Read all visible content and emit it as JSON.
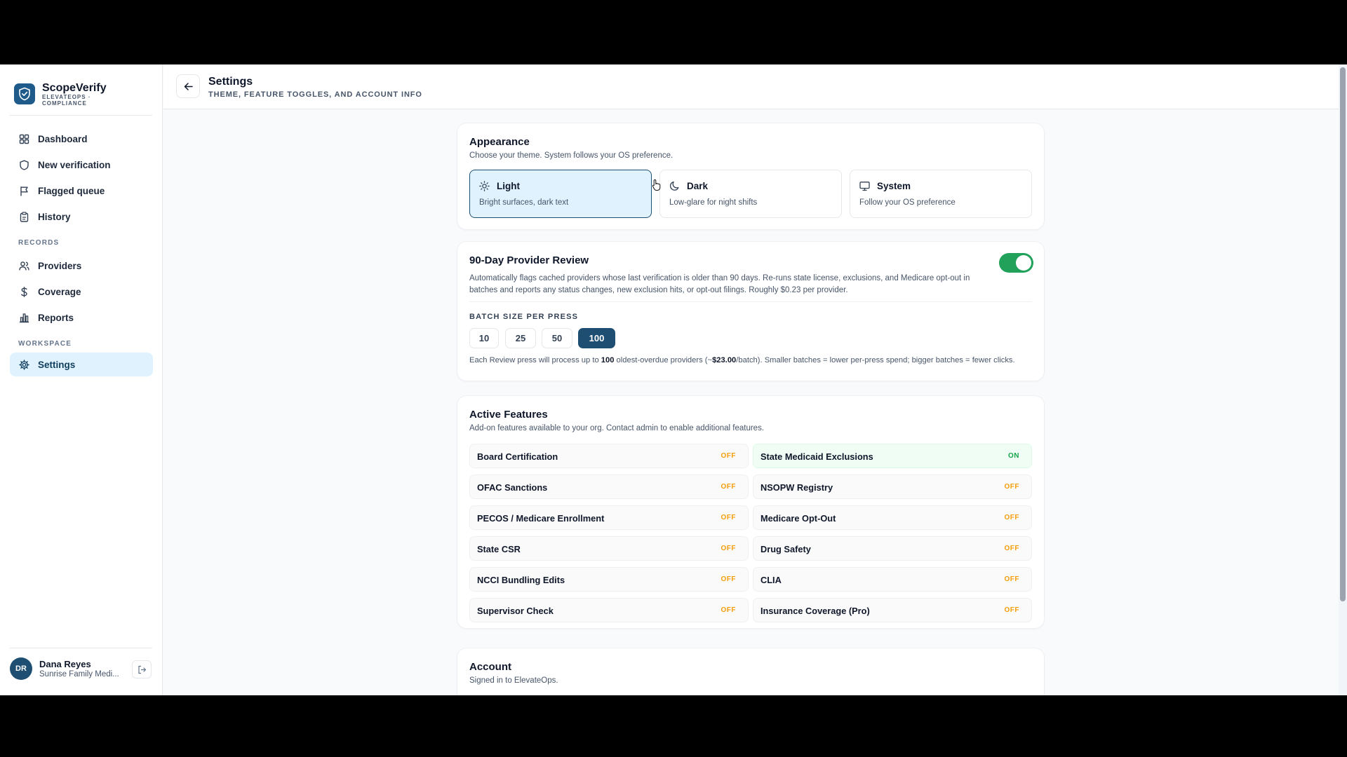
{
  "brand": {
    "name": "ScopeVerify",
    "sub": "ElevateOps · Compliance"
  },
  "nav": {
    "dashboard": "Dashboard",
    "new_verification": "New verification",
    "flagged_queue": "Flagged queue",
    "history": "History",
    "records_label": "RECORDS",
    "providers": "Providers",
    "coverage": "Coverage",
    "reports": "Reports",
    "workspace_label": "WORKSPACE",
    "settings": "Settings"
  },
  "user": {
    "initials": "DR",
    "name": "Dana Reyes",
    "org": "Sunrise Family Medi..."
  },
  "header": {
    "title": "Settings",
    "subtitle": "THEME, FEATURE TOGGLES, AND ACCOUNT INFO"
  },
  "appearance": {
    "title": "Appearance",
    "desc": "Choose your theme. System follows your OS preference.",
    "selected": "Light",
    "options": [
      {
        "label": "Light",
        "desc": "Bright surfaces, dark text",
        "icon": "sun-icon"
      },
      {
        "label": "Dark",
        "desc": "Low-glare for night shifts",
        "icon": "moon-icon"
      },
      {
        "label": "System",
        "desc": "Follow your OS preference",
        "icon": "monitor-icon"
      }
    ]
  },
  "review": {
    "title": "90-Day Provider Review",
    "enabled": true,
    "desc": "Automatically flags cached providers whose last verification is older than 90 days. Re-runs state license, exclusions, and Medicare opt-out in batches and reports any status changes, new exclusion hits, or opt-out filings. Roughly $0.23 per provider.",
    "batch_label": "BATCH SIZE PER PRESS",
    "batch_options": [
      "10",
      "25",
      "50",
      "100"
    ],
    "batch_selected": "100",
    "note_prefix": "Each Review press will process up to ",
    "note_count": "100",
    "note_mid": " oldest-overdue providers (~",
    "note_cost": "$23.00",
    "note_suffix": "/batch). Smaller batches = lower per-press spend; bigger batches = fewer clicks."
  },
  "features": {
    "title": "Active Features",
    "desc": "Add-on features available to your org. Contact admin to enable additional features.",
    "items": [
      {
        "name": "Board Certification",
        "status": "OFF"
      },
      {
        "name": "State Medicaid Exclusions",
        "status": "ON"
      },
      {
        "name": "OFAC Sanctions",
        "status": "OFF"
      },
      {
        "name": "NSOPW Registry",
        "status": "OFF"
      },
      {
        "name": "PECOS / Medicare Enrollment",
        "status": "OFF"
      },
      {
        "name": "Medicare Opt-Out",
        "status": "OFF"
      },
      {
        "name": "State CSR",
        "status": "OFF"
      },
      {
        "name": "Drug Safety",
        "status": "OFF"
      },
      {
        "name": "NCCI Bundling Edits",
        "status": "OFF"
      },
      {
        "name": "CLIA",
        "status": "OFF"
      },
      {
        "name": "Supervisor Check",
        "status": "OFF"
      },
      {
        "name": "Insurance Coverage (Pro)",
        "status": "OFF"
      }
    ]
  },
  "account": {
    "title": "Account",
    "desc": "Signed in to ElevateOps."
  },
  "colors": {
    "brand": "#1e4e72",
    "toggle_on": "#22a15a",
    "status_off": "#f59e0b",
    "status_on": "#16a34a",
    "active_nav_bg": "#e0f2fe"
  }
}
